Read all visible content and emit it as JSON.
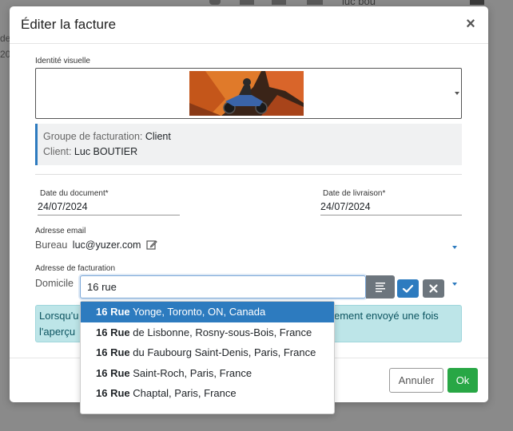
{
  "background": {
    "top_user_text": "luc bou",
    "side_text_1": "de",
    "side_text_2": "20"
  },
  "modal": {
    "title": "Éditer la facture",
    "close_glyph": "×"
  },
  "visual_identity": {
    "label": "Identité visuelle"
  },
  "billing_group": {
    "group_label": "Groupe de facturation:",
    "group_value": "Client",
    "client_label": "Client:",
    "client_value": "Luc BOUTIER"
  },
  "dates": {
    "document_label": "Date du document*",
    "document_value": "24/07/2024",
    "delivery_label": "Date de livraison*",
    "delivery_value": "24/07/2024"
  },
  "email": {
    "label": "Adresse email",
    "type": "Bureau",
    "value": "luc@yuzer.com"
  },
  "billing_address": {
    "label": "Adresse de facturation",
    "type": "Domicile",
    "input_value": "16 rue"
  },
  "alert": {
    "text_left_1": "Lorsqu'u",
    "text_left_2": "l'aperçu",
    "text_right": "ement envoyé une fois"
  },
  "suggestions": [
    {
      "bold": "16 Rue",
      "rest": " Yonge, Toronto, ON, Canada",
      "active": true
    },
    {
      "bold": "16 Rue",
      "rest": " de Lisbonne, Rosny-sous-Bois, France",
      "active": false
    },
    {
      "bold": "16 Rue",
      "rest": " du Faubourg Saint-Denis, Paris, France",
      "active": false
    },
    {
      "bold": "16 Rue",
      "rest": " Saint-Roch, Paris, France",
      "active": false
    },
    {
      "bold": "16 Rue",
      "rest": " Chaptal, Paris, France",
      "active": false
    }
  ],
  "footer": {
    "cancel_label": "Annuler",
    "ok_label": "Ok"
  },
  "colors": {
    "primary": "#2d7bbf",
    "success": "#28a745",
    "secondary": "#6c757d",
    "info_bg": "#bde5e8"
  }
}
